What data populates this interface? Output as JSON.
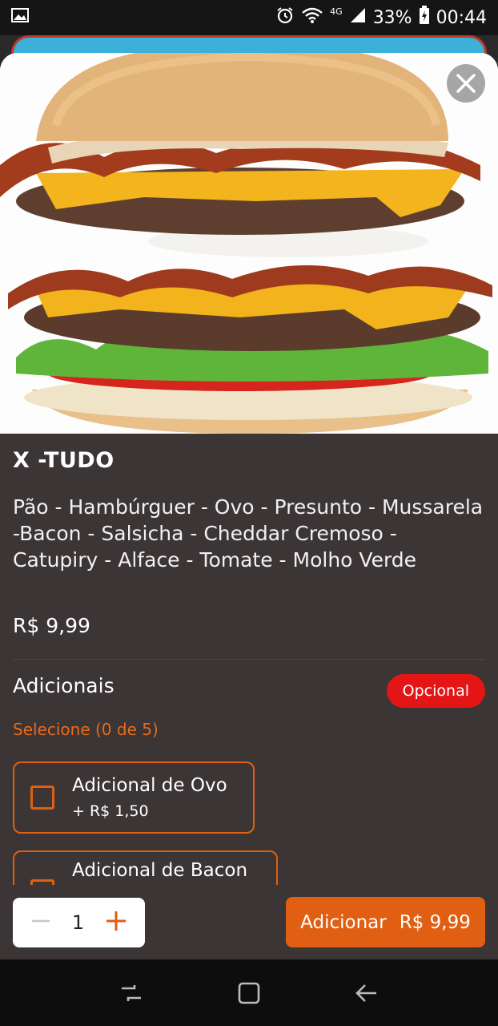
{
  "status_bar": {
    "network": "4G",
    "battery": "33%",
    "time": "00:44",
    "icons": [
      "image-icon",
      "alarm-icon",
      "wifi-icon",
      "signal-icon",
      "battery-icon"
    ]
  },
  "product": {
    "name": "X -TUDO",
    "description": "Pão - Hambúrguer  - Ovo - Presunto - Mussarela -Bacon - Salsicha - Cheddar Cremoso - Catupiry  - Alface - Tomate - Molho Verde",
    "price": "R$ 9,99"
  },
  "extras_section": {
    "title": "Adicionais",
    "badge": "Opcional",
    "hint": "Selecione (0 de 5)",
    "items": [
      {
        "name": "Adicional de Ovo",
        "price": "+ R$ 1,50"
      },
      {
        "name": "Adicional de Bacon",
        "price": ""
      }
    ]
  },
  "footer": {
    "quantity": "1",
    "add_label": "Adicionar",
    "add_price": "R$ 9,99"
  },
  "colors": {
    "accent": "#e05f12",
    "badge": "#e31515",
    "sheet_bg": "#3b3536"
  }
}
